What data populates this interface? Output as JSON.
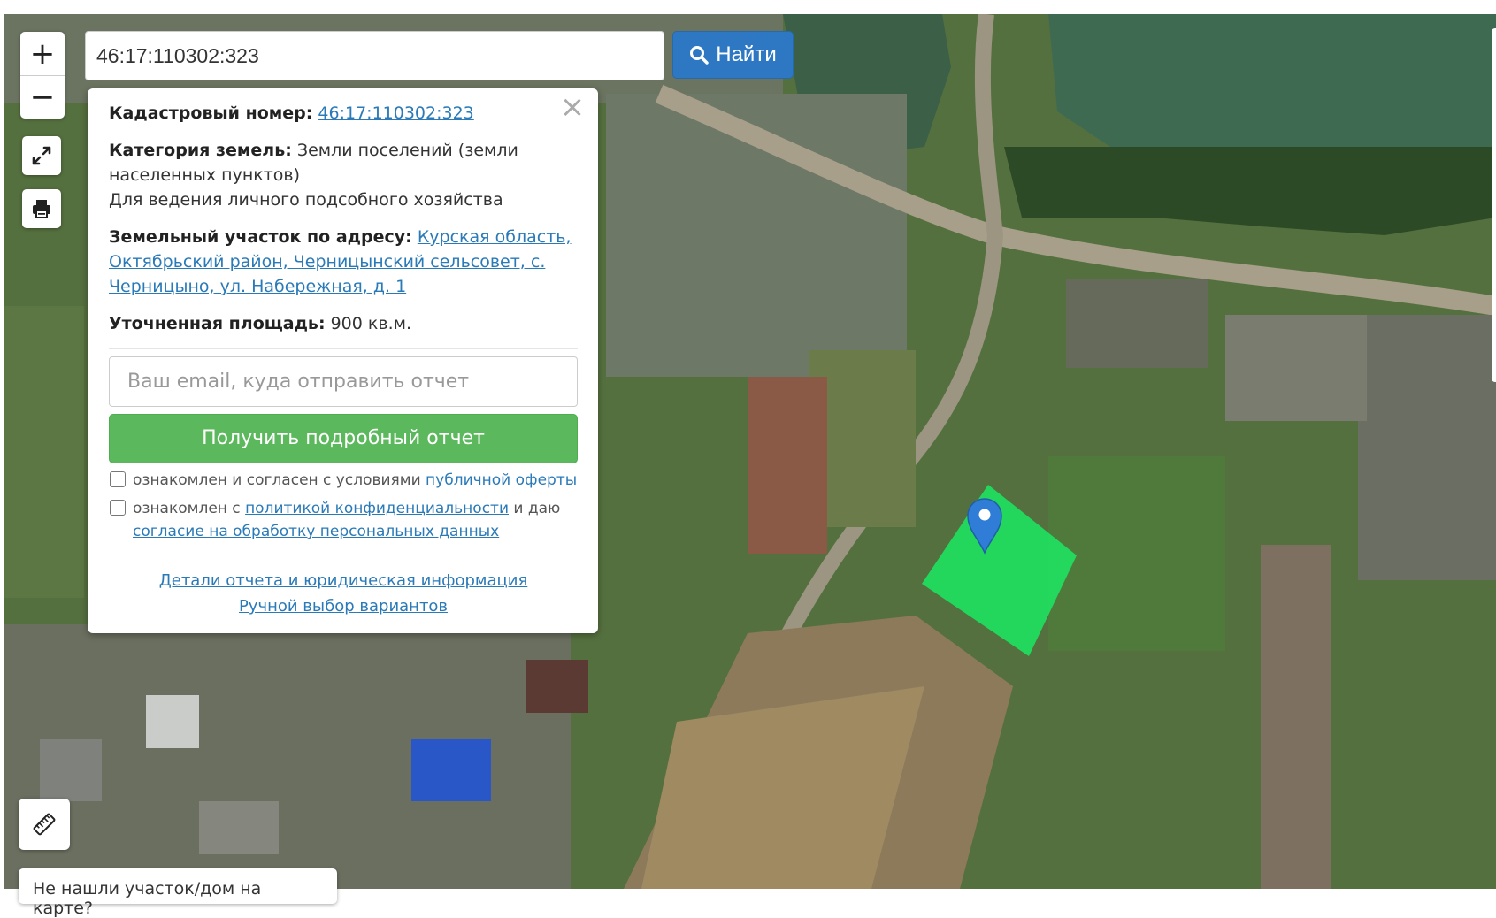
{
  "search": {
    "value": "46:17:110302:323",
    "button_label": "Найти"
  },
  "zoom": {
    "in_label": "+",
    "out_label": "−"
  },
  "popup": {
    "close_label": "×",
    "cadastral_label": "Кадастровый номер:",
    "cadastral_value": "46:17:110302:323",
    "category_label": "Категория земель:",
    "category_value": "Земли поселений (земли населенных пунктов)",
    "usage_value": "Для ведения личного подсобного хозяйства",
    "address_label": "Земельный участок по адресу:",
    "address_value": "Курская область, Октябрьский район, Черницынский сельсовет, с. Черницыно, ул. Набережная, д. 1",
    "area_label": "Уточненная площадь:",
    "area_value": "900 кв.м.",
    "email_placeholder": "Ваш email, куда отправить отчет",
    "report_button": "Получить подробный отчет",
    "terms_text": "ознакомлен и согласен с условиями ",
    "terms_link": "публичной оферты",
    "privacy_text": "ознакомлен с ",
    "privacy_link": "политикой конфиденциальности",
    "privacy_text2": " и даю ",
    "consent_link": "согласие на обработку персональных данных",
    "details_link": "Детали отчета и юридическая информация",
    "manual_link": "Ручной выбор вариантов"
  },
  "notfound_label": "Не нашли участок/дом на карте?",
  "colors": {
    "parcel": "#1fe05f",
    "marker": "#2f7dd6",
    "search_button": "#2e78c3",
    "report_button": "#5cb85c",
    "link": "#2a7ab8"
  },
  "icons": [
    "search-icon",
    "plus-icon",
    "minus-icon",
    "expand-icon",
    "print-icon",
    "ruler-icon",
    "map-marker-icon",
    "close-icon"
  ]
}
